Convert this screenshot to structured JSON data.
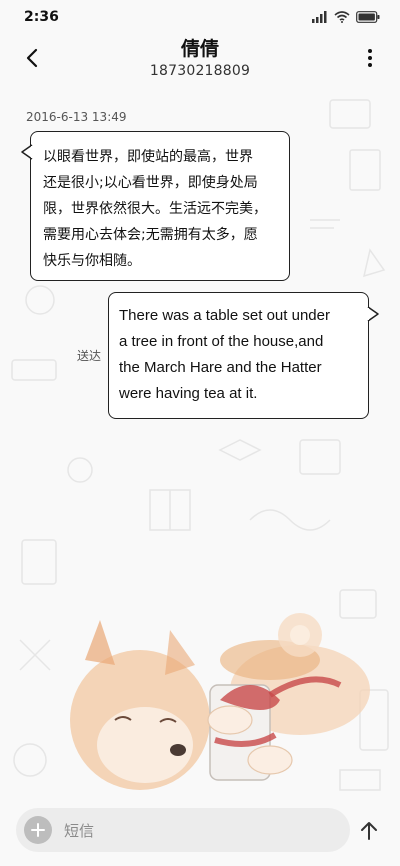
{
  "status_bar": {
    "time": "2:36",
    "icons": [
      "signal-icon",
      "wifi-icon",
      "battery-icon"
    ]
  },
  "header": {
    "back_icon": "chevron-left-icon",
    "contact_name": "倩倩",
    "contact_number": "18730218809",
    "more_icon": "more-vertical-icon"
  },
  "conversation": {
    "timestamp": "2016-6-13 13:49",
    "incoming": {
      "lines": [
        "以眼看世界，即使站的最高，世界",
        "还是很小;以心看世界，即使身处局",
        "限，世界依然很大。生活远不完美，",
        "需要用心去体会;无需拥有太多，愿",
        "快乐与你相随。"
      ]
    },
    "outgoing": {
      "lines": [
        "There was a table set out under",
        "a tree in front of the house,and",
        "the March Hare and the Hatter",
        "were having tea at it."
      ],
      "status": "送达"
    }
  },
  "composer": {
    "add_icon": "plus-icon",
    "placeholder": "短信",
    "send_icon": "arrow-up-icon"
  },
  "colors": {
    "background": "#f9f9f9",
    "bubble_border": "#222222",
    "input_background": "#ececec",
    "shiba_orange": "#e8a36a"
  }
}
